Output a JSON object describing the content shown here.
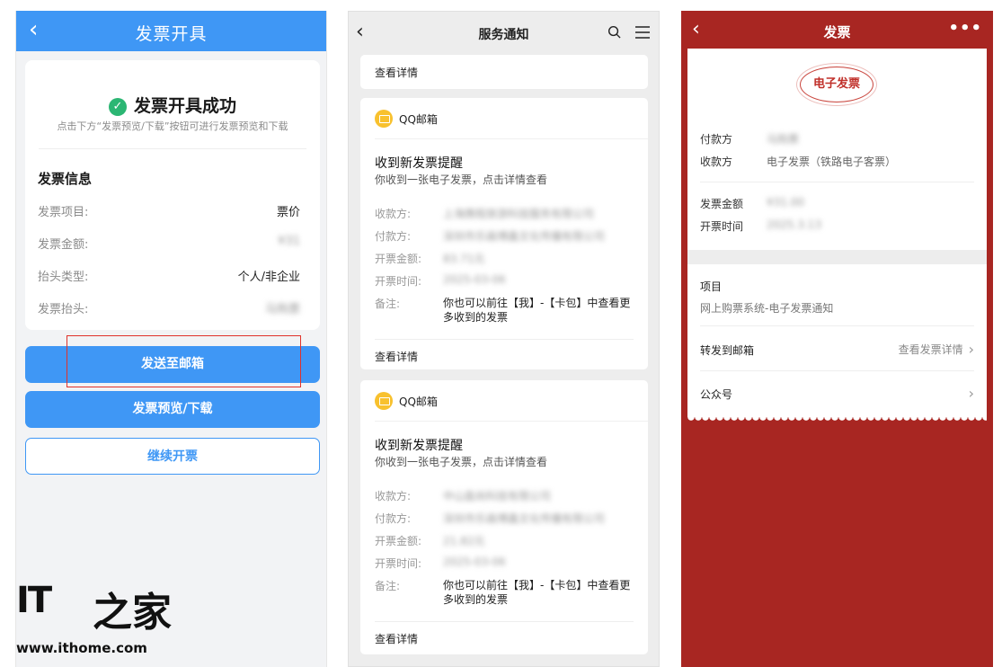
{
  "panel1": {
    "nav": {
      "back": "‹",
      "title": "发票开具"
    },
    "success": {
      "title": "发票开具成功",
      "subtitle": "点击下方“发票预览/下载”按钮可进行发票预览和下载"
    },
    "info": {
      "title": "发票信息",
      "rows": [
        {
          "label": "发票项目:",
          "value": "票价"
        },
        {
          "label": "发票金额:",
          "value": "¥31"
        },
        {
          "label": "抬头类型:",
          "value": "个人/非企业"
        },
        {
          "label": "发票抬头:",
          "value": "马购票"
        }
      ]
    },
    "buttons": {
      "send_email": "发送至邮箱",
      "preview": "发票预览/下载",
      "continue": "继续开票"
    },
    "logo": {
      "it": "IT",
      "zh": "之家",
      "url": "www.ithome.com"
    }
  },
  "panel2": {
    "nav": {
      "back": "‹",
      "title": "服务通知"
    },
    "top_detail": "查看详情",
    "cards": [
      {
        "sender": "QQ邮箱",
        "title": "收到新发票提醒",
        "subtitle": "你收到一张电子发票，点击详情查看",
        "payee_label": "收款方:",
        "payee": "上海携程旅游科技服务有限公司",
        "payer_label": "付款方:",
        "payer": "深圳市乐画博鑫文化传播有限公司",
        "amount_label": "开票金额:",
        "amount": "83.71元",
        "date_label": "开票时间:",
        "date": "2025-03-06",
        "note_label": "备注:",
        "note": "你也可以前往【我】-【卡包】中查看更多收到的发票",
        "detail": "查看详情"
      },
      {
        "sender": "QQ邮箱",
        "title": "收到新发票提醒",
        "subtitle": "你收到一张电子发票，点击详情查看",
        "payee_label": "收款方:",
        "payee": "中山盈尚科技有限公司",
        "payer_label": "付款方:",
        "payer": "深圳市乐画博鑫文化传播有限公司",
        "amount_label": "开票金额:",
        "amount": "21.82元",
        "date_label": "开票时间:",
        "date": "2025-03-06",
        "note_label": "备注:",
        "note": "你也可以前往【我】-【卡包】中查看更多收到的发票",
        "detail": "查看详情"
      }
    ]
  },
  "panel3": {
    "nav": {
      "back": "‹",
      "title": "发票",
      "more": "•••"
    },
    "stamp": "电子发票",
    "payer_label": "付款方",
    "payer": "马购票",
    "payee_label": "收款方",
    "payee": "电子发票（铁路电子客票）",
    "amount_label": "发票金额",
    "amount": "¥31.00",
    "date_label": "开票时间",
    "date": "2025.3.13",
    "item_label": "项目",
    "item_value": "网上购票系统-电子发票通知",
    "forward_label": "转发到邮箱",
    "view_detail": "查看发票详情",
    "official_label": "公众号"
  },
  "colors": {
    "blue": "#3f97f5",
    "red_bg": "#a82622",
    "success_green": "#2bb673",
    "amount_orange": "#f39a3a"
  }
}
